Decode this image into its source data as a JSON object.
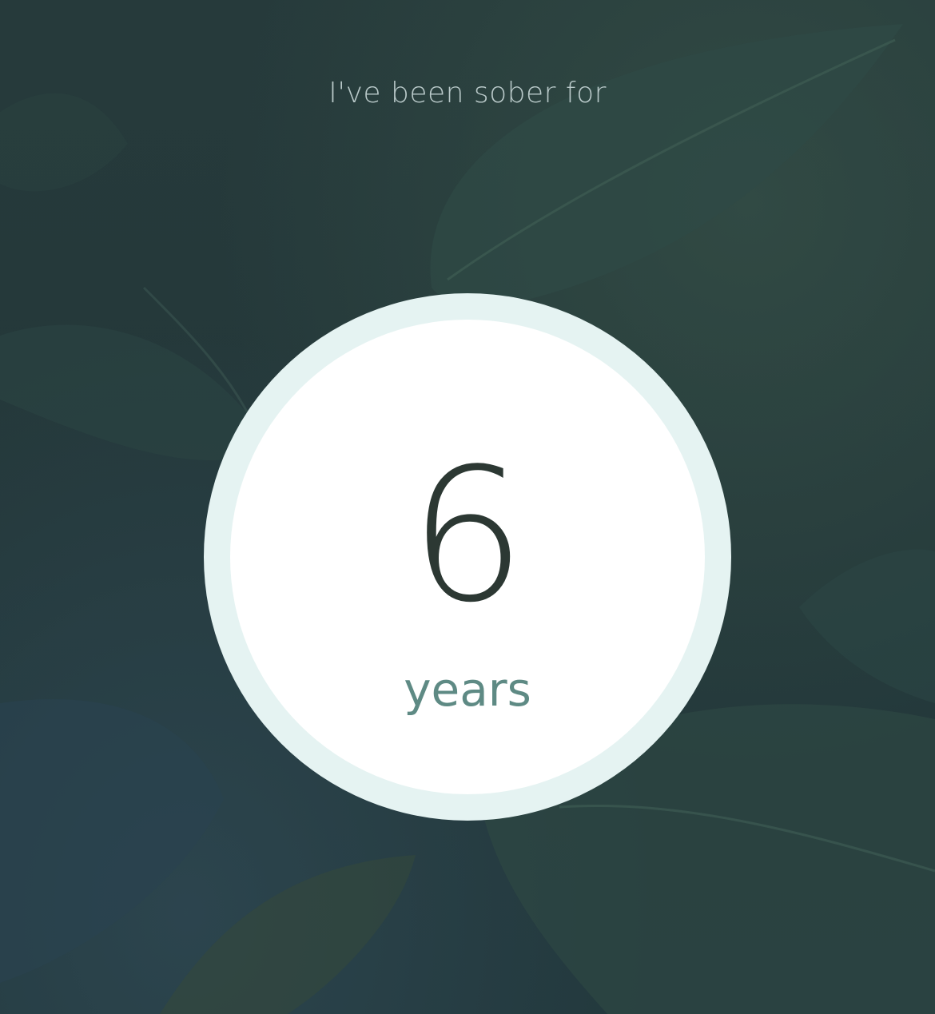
{
  "header": {
    "caption": "I've been sober for"
  },
  "counter": {
    "value": "6",
    "unit": "years"
  },
  "background": {
    "icon": "leaves-background-image"
  },
  "colors": {
    "caption": "#b9c9c9",
    "ring": "#e5f3f2",
    "value": "#2c3833",
    "unit": "#5e8a84"
  }
}
